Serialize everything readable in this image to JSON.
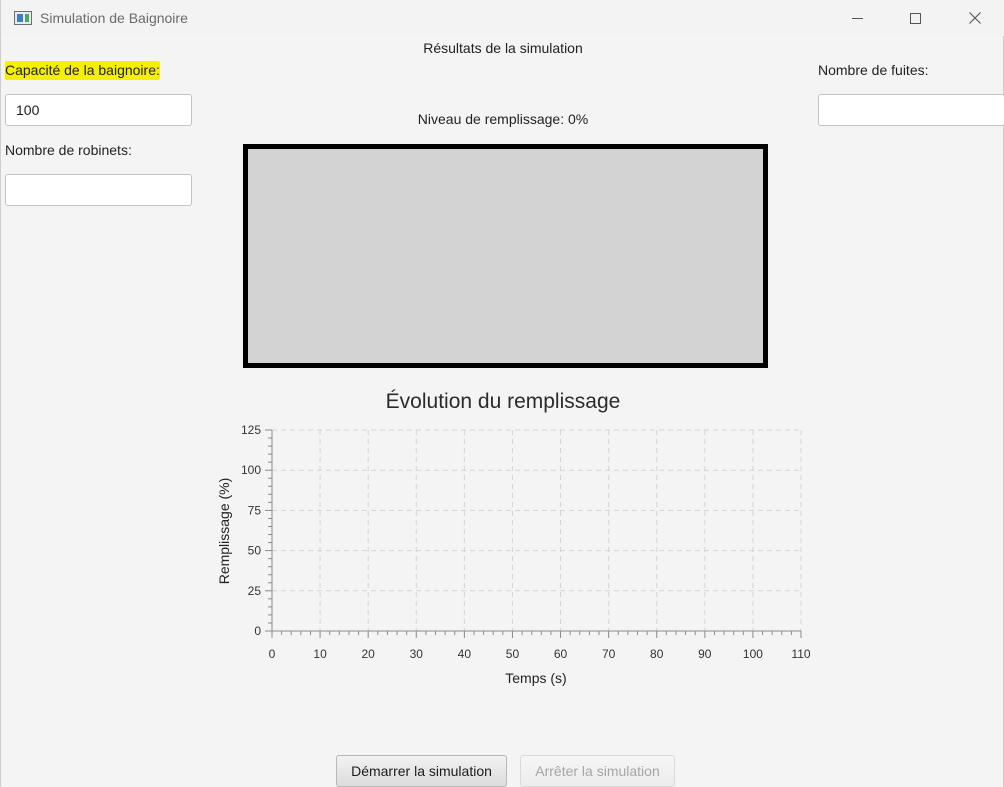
{
  "window": {
    "title": "Simulation de Baignoire",
    "icon": "app-window-icon"
  },
  "form": {
    "capacity_label": "Capacité de la baignoire:",
    "capacity_value": "100",
    "faucets_label": "Nombre de robinets:",
    "faucets_value": "",
    "leaks_label": "Nombre de fuites:",
    "leaks_value": ""
  },
  "results": {
    "title": "Résultats de la simulation",
    "fill_level_text": "Niveau de remplissage: 0%",
    "fill_level_percent": 0,
    "tub_color": "#d3d3d3",
    "water_color": "#4a90e2"
  },
  "chart_data": {
    "type": "line",
    "title": "Évolution du remplissage",
    "xlabel": "Temps (s)",
    "ylabel": "Remplissage (%)",
    "xlim": [
      0,
      110
    ],
    "ylim": [
      0,
      125
    ],
    "x_ticks": [
      0,
      10,
      20,
      30,
      40,
      50,
      60,
      70,
      80,
      90,
      100,
      110
    ],
    "y_ticks": [
      0,
      25,
      50,
      75,
      100,
      125
    ],
    "grid": true,
    "series": []
  },
  "buttons": {
    "start_label": "Démarrer la simulation",
    "stop_label": "Arrêter la simulation",
    "stop_disabled": true
  }
}
